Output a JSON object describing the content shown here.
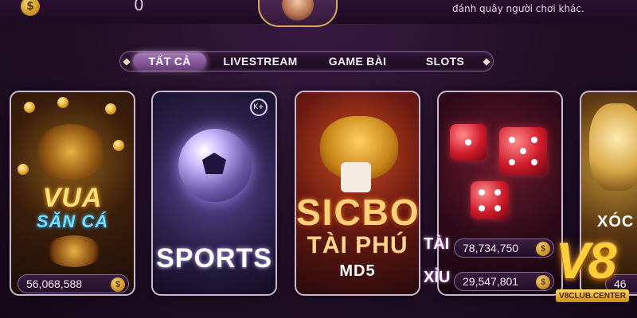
{
  "header": {
    "currency_icon": "dollar-coin-icon",
    "balance": "0",
    "message": "đánh quây người chơi khác."
  },
  "tabs": [
    {
      "label": "TẤT CẢ",
      "active": true
    },
    {
      "label": "LIVESTREAM",
      "active": false
    },
    {
      "label": "GAME BÀI",
      "active": false
    },
    {
      "label": "SLOTS",
      "active": false
    }
  ],
  "games": [
    {
      "title": "VUA",
      "subtitle": "SĂN CÁ",
      "jackpot": "56,068,588"
    },
    {
      "title": "SPORTS",
      "badge": "K+"
    },
    {
      "title": "SICBO",
      "subtitle": "TÀI PHÚ",
      "edition": "MD5",
      "tai_label": "TÀI",
      "tai_value": "78,734,750",
      "xiu_label": "XỈU",
      "xiu_value": "29,547,801"
    },
    {
      "title": "XÓC",
      "jackpot": "46"
    }
  ],
  "logo": {
    "mark": "V8",
    "domain": "V8CLUB.CENTER"
  },
  "colors": {
    "accent_gold": "#ffcf3a",
    "tab_active": "#a77ab8",
    "background": "#241028"
  }
}
